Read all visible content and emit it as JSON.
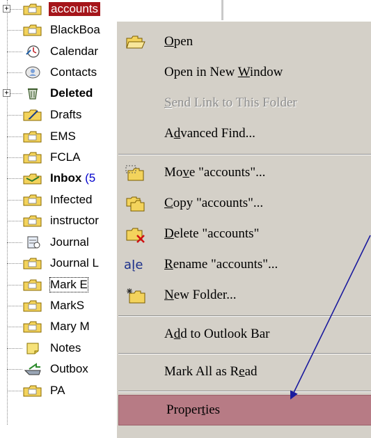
{
  "folder_tree": {
    "items": [
      {
        "label": "accounts",
        "icon": "folder-icon",
        "selected": true,
        "expander": "+"
      },
      {
        "label": "BlackBoa",
        "icon": "folder-icon"
      },
      {
        "label": "Calendar",
        "icon": "calendar-icon"
      },
      {
        "label": "Contacts",
        "icon": "contacts-icon"
      },
      {
        "label": "Deleted",
        "icon": "deleted-items-icon",
        "bold": true,
        "expander": "+"
      },
      {
        "label": "Drafts",
        "icon": "drafts-icon"
      },
      {
        "label": "EMS",
        "icon": "folder-icon"
      },
      {
        "label": "FCLA",
        "icon": "folder-icon"
      },
      {
        "label": "Inbox",
        "count": "(5",
        "icon": "inbox-icon",
        "bold": true
      },
      {
        "label": "Infected",
        "icon": "folder-icon"
      },
      {
        "label": "instructor",
        "icon": "folder-icon"
      },
      {
        "label": "Journal",
        "icon": "journal-icon"
      },
      {
        "label": "Journal L",
        "icon": "folder-icon"
      },
      {
        "label": "Mark E",
        "icon": "folder-icon",
        "focused": true
      },
      {
        "label": "MarkS",
        "icon": "folder-icon"
      },
      {
        "label": "Mary M",
        "icon": "folder-icon"
      },
      {
        "label": "Notes",
        "icon": "notes-icon"
      },
      {
        "label": "Outbox",
        "icon": "outbox-icon"
      },
      {
        "label": "PA",
        "icon": "folder-icon"
      }
    ]
  },
  "context_menu": {
    "open": {
      "pre": "",
      "u": "O",
      "post": "pen",
      "icon": "open-folder-icon"
    },
    "open_new_window": {
      "pre": "Open in New ",
      "u": "W",
      "post": "indow"
    },
    "send_link": {
      "pre": "",
      "u": "S",
      "post": "end Link to This Folder",
      "disabled": true
    },
    "advanced_find": {
      "pre": "A",
      "u": "d",
      "post": "vanced Find..."
    },
    "move": {
      "pre": "Mo",
      "u": "v",
      "post": "e \"accounts\"...",
      "icon": "move-folder-icon"
    },
    "copy": {
      "pre": "",
      "u": "C",
      "post": "opy \"accounts\"...",
      "icon": "copy-folder-icon"
    },
    "delete": {
      "pre": "",
      "u": "D",
      "post": "elete \"accounts\"",
      "icon": "delete-folder-icon"
    },
    "rename": {
      "pre": "",
      "u": "R",
      "post": "ename \"accounts\"...",
      "icon": "rename-icon",
      "icon_text": "aĮe"
    },
    "new_folder": {
      "pre": "",
      "u": "N",
      "post": "ew Folder...",
      "icon": "new-folder-icon"
    },
    "add_outlook_bar": {
      "pre": "A",
      "u": "d",
      "post": "d to Outlook Bar"
    },
    "mark_all_read": {
      "pre": "Mark All as R",
      "u": "e",
      "post": "ad"
    },
    "properties": {
      "pre": "Proper",
      "u": "t",
      "post": "ies",
      "highlighted": true
    }
  },
  "colors": {
    "selection": "#a5151a",
    "menu_background": "#d4d0c8",
    "menu_highlight": "#b77b85",
    "annotation_arrow": "#1a1a9e",
    "folder_yellow": "#f3d35c"
  }
}
